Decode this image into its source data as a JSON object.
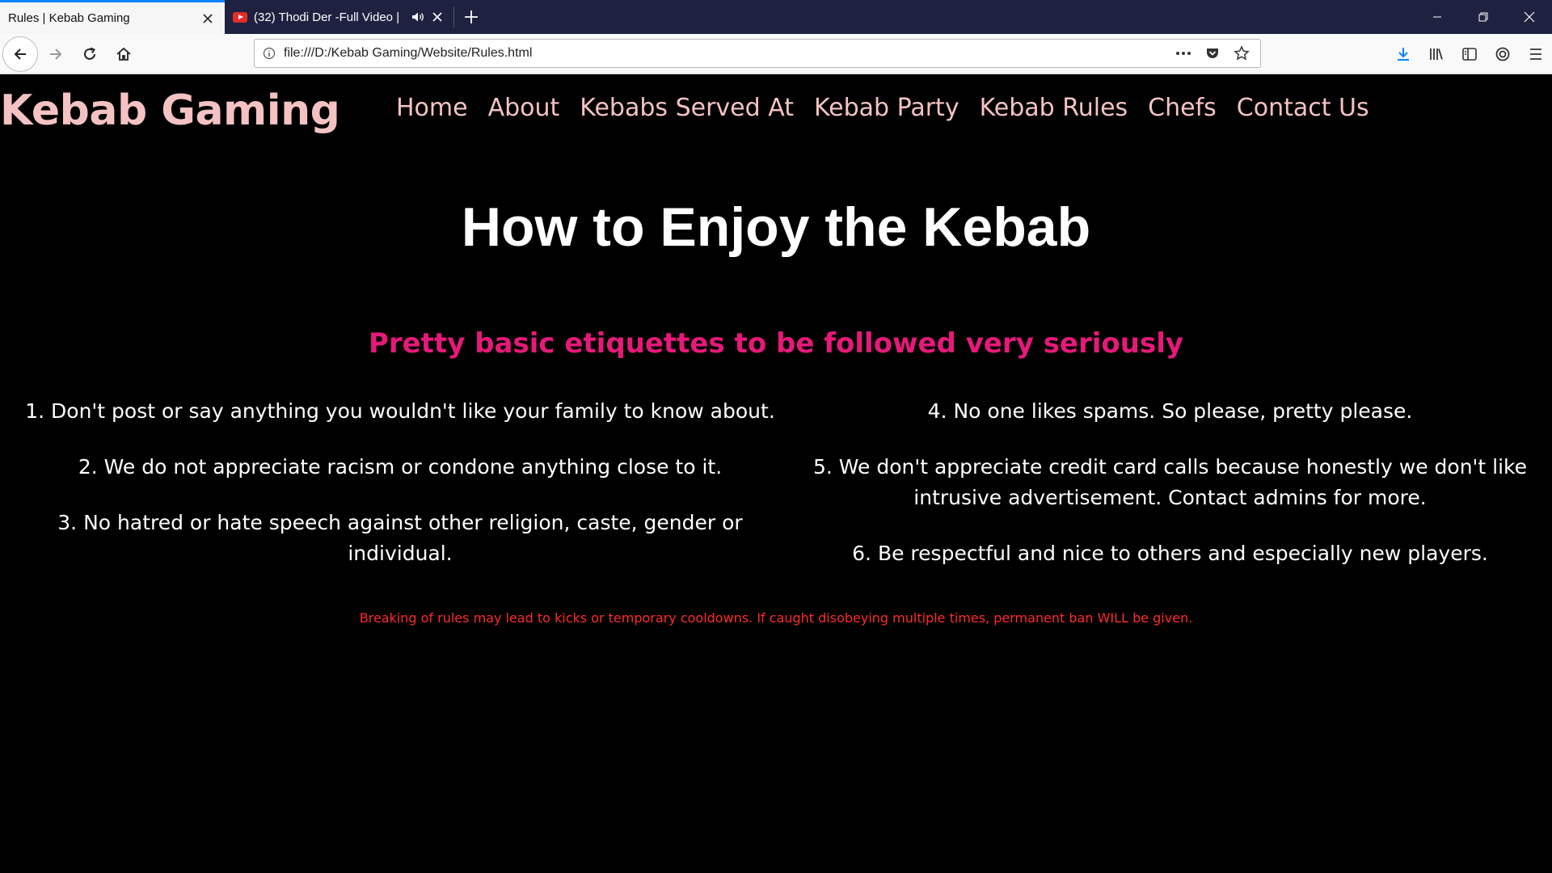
{
  "browser": {
    "tabs": [
      {
        "title": "Rules | Kebab Gaming",
        "active": true
      },
      {
        "title": "(32) Thodi Der -Full Video |",
        "active": false
      }
    ],
    "url": "file:///D:/Kebab Gaming/Website/Rules.html",
    "accent_color": "#0a84ff",
    "tabbar_color": "#1f2140"
  },
  "site": {
    "logo": "Kebab Gaming",
    "nav": [
      "Home",
      "About",
      "Kebabs Served At",
      "Kebab Party",
      "Kebab Rules",
      "Chefs",
      "Contact Us"
    ],
    "nav_color": "#f4c2c2"
  },
  "main": {
    "title": "How to Enjoy the Kebab",
    "subtitle": "Pretty basic etiquettes to be followed very seriously",
    "subtitle_color": "#e6197a",
    "rules_left": [
      "1. Don't post or say anything you wouldn't like your family to know about.",
      "2. We do not appreciate racism or condone anything close to it.",
      "3. No hatred or hate speech against other religion, caste, gender or individual."
    ],
    "rules_right": [
      "4. No one likes spams. So please, pretty please.",
      "5. We don't appreciate credit card calls because honestly we don't like intrusive advertisement. Contact admins for more.",
      "6. Be respectful and nice to others and especially new players."
    ],
    "warning": "Breaking of rules may lead to kicks or temporary cooldowns. If caught disobeying multiple times, permanent ban WILL be given.",
    "warning_color": "#ff2a2a"
  }
}
